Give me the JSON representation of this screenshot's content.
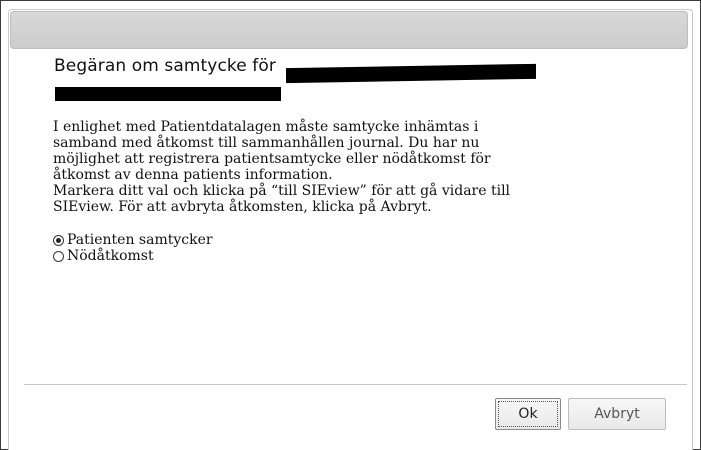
{
  "dialog": {
    "title_prefix": "Begäran om samtycke för",
    "body_paragraphs": [
      "I enlighet med Patientdatalagen måste samtycke inhämtas i samband med åtkomst till sammanhållen journal. Du har nu möjlighet att registrera patientsamtycke eller nödåtkomst för åtkomst av denna patients information.",
      "Markera ditt val och klicka på “till SIEview” för att gå vidare till SIEview. För att avbryta åtkomsten, klicka på Avbryt."
    ],
    "options": [
      {
        "label": "Patienten samtycker",
        "selected": true
      },
      {
        "label": "Nödåtkomst",
        "selected": false
      }
    ],
    "buttons": {
      "ok_label": "Ok",
      "cancel_label": "Avbryt"
    }
  },
  "colors": {
    "titlebar": "#cccccc",
    "border": "#c9c9c9",
    "redaction": "#000000"
  }
}
